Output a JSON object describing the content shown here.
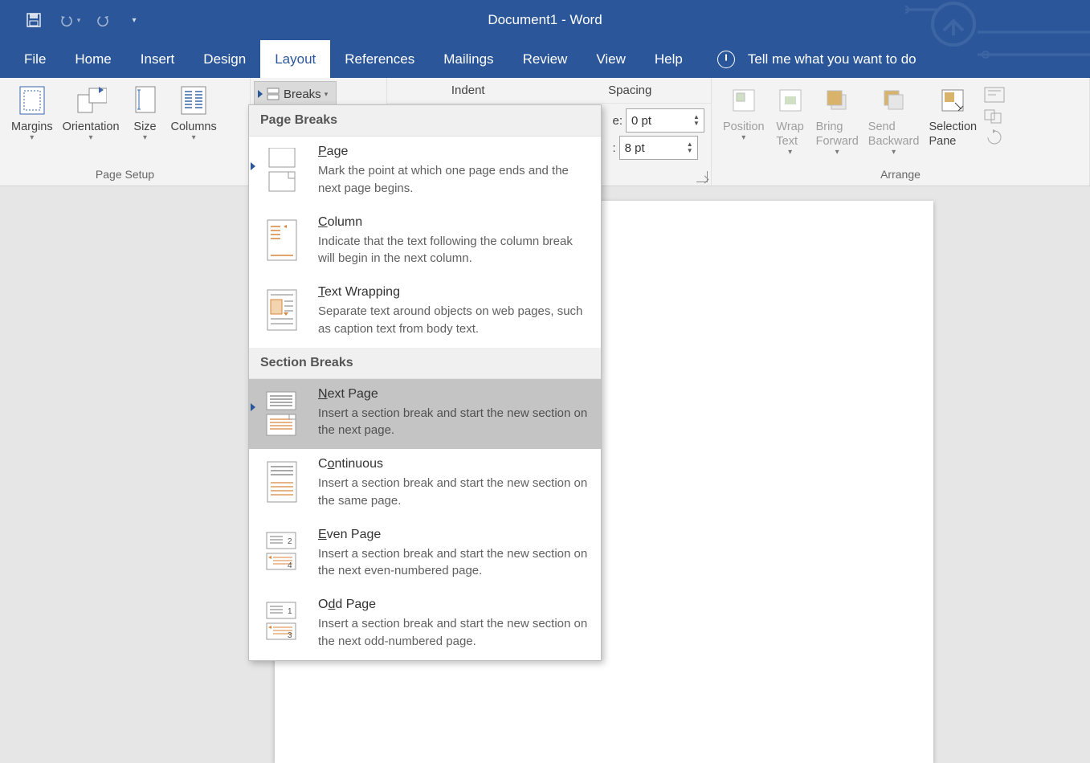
{
  "app": {
    "title": "Document1  -  Word"
  },
  "qat": {
    "save": "save",
    "undo": "undo",
    "redo": "redo",
    "more": "more"
  },
  "tabs": {
    "file": "File",
    "home": "Home",
    "insert": "Insert",
    "design": "Design",
    "layout": "Layout",
    "references": "References",
    "mailings": "Mailings",
    "review": "Review",
    "view": "View",
    "help": "Help",
    "tellme": "Tell me what you want to do"
  },
  "ribbon": {
    "page_setup": {
      "margins": "Margins",
      "orientation": "Orientation",
      "size": "Size",
      "columns": "Columns",
      "caption": "Page Setup",
      "breaks": "Breaks"
    },
    "paragraph": {
      "indent_header": "Indent",
      "spacing_header": "Spacing",
      "before_label": "e:",
      "after_label": ":",
      "before_value": "0 pt",
      "after_value": "8 pt"
    },
    "arrange": {
      "position": "Position",
      "wrap": "Wrap\nText",
      "bring": "Bring\nForward",
      "send": "Send\nBackward",
      "selection": "Selection\nPane",
      "caption": "Arrange"
    }
  },
  "breaks_menu": {
    "page_breaks_header": "Page Breaks",
    "section_breaks_header": "Section Breaks",
    "items": {
      "page": {
        "title_pre": "",
        "title_u": "P",
        "title_post": "age",
        "desc": "Mark the point at which one page ends and the next page begins."
      },
      "column": {
        "title_pre": "",
        "title_u": "C",
        "title_post": "olumn",
        "desc": "Indicate that the text following the column break will begin in the next column."
      },
      "textwrap": {
        "title_pre": "",
        "title_u": "T",
        "title_post": "ext Wrapping",
        "desc": "Separate text around objects on web pages, such as caption text from body text."
      },
      "nextpage": {
        "title_pre": "",
        "title_u": "N",
        "title_post": "ext Page",
        "desc": "Insert a section break and start the new section on the next page."
      },
      "continuous": {
        "title_pre": "C",
        "title_u": "o",
        "title_post": "ntinuous",
        "desc": "Insert a section break and start the new section on the same page."
      },
      "evenpage": {
        "title_pre": "",
        "title_u": "E",
        "title_post": "ven Page",
        "desc": "Insert a section break and start the new section on the next even-numbered page."
      },
      "oddpage": {
        "title_pre": "O",
        "title_u": "d",
        "title_post": "d Page",
        "desc": "Insert a section break and start the new section on the next odd-numbered page."
      }
    }
  }
}
